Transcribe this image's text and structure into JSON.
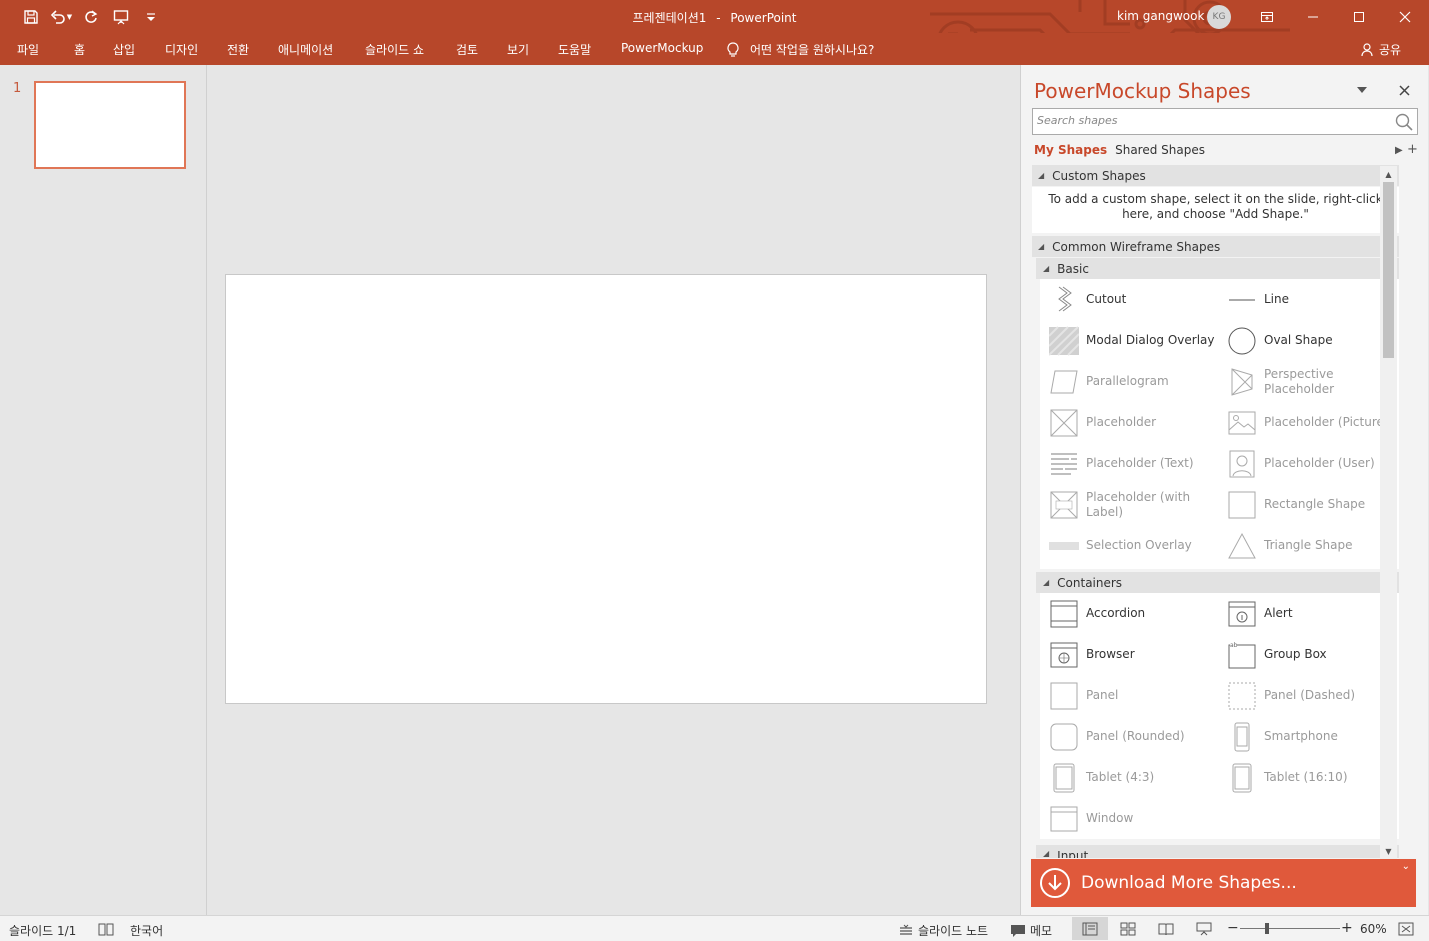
{
  "window": {
    "doc_name": "프레젠테이션1",
    "separator": "-",
    "app_name": "PowerPoint",
    "user_name": "kim gangwook",
    "user_initials": "KG"
  },
  "ribbon": {
    "tabs": [
      "파일",
      "홈",
      "삽입",
      "디자인",
      "전환",
      "애니메이션",
      "슬라이드 쇼",
      "검토",
      "보기",
      "도움말",
      "PowerMockup"
    ],
    "tell_me": "어떤 작업을 원하시나요?",
    "share": "공유"
  },
  "thumbnails": {
    "slide_number": "1"
  },
  "pane": {
    "title": "PowerMockup Shapes",
    "search_placeholder": "Search shapes",
    "my_shapes": "My Shapes",
    "shared_shapes": "Shared Shapes",
    "custom_header": "Custom Shapes",
    "custom_info": "To add a custom shape, select it on the slide, right-click here, and choose \"Add Shape.\"",
    "common_header": "Common Wireframe Shapes",
    "basic_header": "Basic",
    "basic_items": [
      {
        "label": "Cutout",
        "icon": "cutout-icon"
      },
      {
        "label": "Line",
        "icon": "line-icon"
      },
      {
        "label": "Modal Dialog Overlay",
        "icon": "modal-overlay-icon"
      },
      {
        "label": "Oval Shape",
        "icon": "oval-icon"
      },
      {
        "label": "Parallelogram",
        "icon": "parallelogram-icon"
      },
      {
        "label": "Perspective Placeholder",
        "icon": "perspective-placeholder-icon"
      },
      {
        "label": "Placeholder",
        "icon": "placeholder-icon"
      },
      {
        "label": "Placeholder (Picture)",
        "icon": "picture-icon"
      },
      {
        "label": "Placeholder (Text)",
        "icon": "text-lines-icon"
      },
      {
        "label": "Placeholder (User)",
        "icon": "user-icon"
      },
      {
        "label": "Placeholder (with Label)",
        "icon": "label-placeholder-icon"
      },
      {
        "label": "Rectangle Shape",
        "icon": "rectangle-icon"
      },
      {
        "label": "Selection Overlay",
        "icon": "selection-overlay-icon"
      },
      {
        "label": "Triangle Shape",
        "icon": "triangle-icon"
      }
    ],
    "containers_header": "Containers",
    "containers_items": [
      {
        "label": "Accordion",
        "icon": "accordion-icon"
      },
      {
        "label": "Alert",
        "icon": "alert-icon"
      },
      {
        "label": "Browser",
        "icon": "browser-icon"
      },
      {
        "label": "Group Box",
        "icon": "group-box-icon"
      },
      {
        "label": "Panel",
        "icon": "panel-icon"
      },
      {
        "label": "Panel (Dashed)",
        "icon": "panel-dashed-icon"
      },
      {
        "label": "Panel (Rounded)",
        "icon": "panel-rounded-icon"
      },
      {
        "label": "Smartphone",
        "icon": "smartphone-icon"
      },
      {
        "label": "Tablet (4:3)",
        "icon": "tablet-4-3-icon"
      },
      {
        "label": "Tablet (16:10)",
        "icon": "tablet-16-10-icon"
      },
      {
        "label": "Window",
        "icon": "window-icon"
      }
    ],
    "input_header": "Input",
    "download": "Download More Shapes..."
  },
  "status": {
    "slide_info": "슬라이드 1/1",
    "language": "한국어",
    "notes": "슬라이드 노트",
    "comments": "메모",
    "zoom": "60%"
  },
  "colors": {
    "accent": "#b7472a",
    "pane_title": "#c8482a",
    "download_bar": "#e0593b"
  }
}
